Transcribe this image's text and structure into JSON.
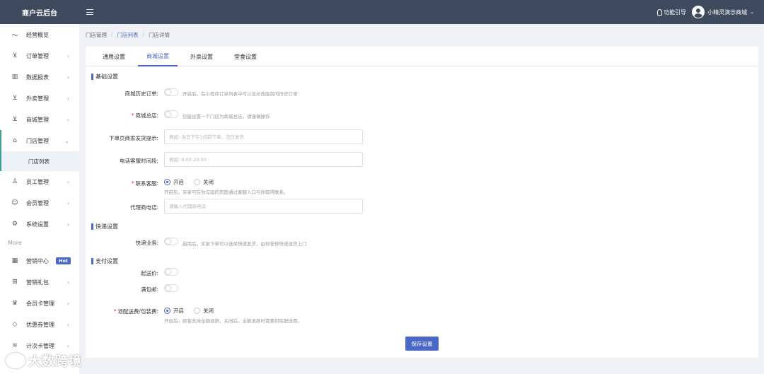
{
  "header": {
    "brand": "商户云后台",
    "guide_label": "功能引导",
    "user_name": "小精灵演示商城",
    "caret": "⌄"
  },
  "sidebar": {
    "items": [
      {
        "label": "经营概览",
        "icon": "trend-chart-icon",
        "glyph": "〜",
        "arrow": ""
      },
      {
        "label": "订单管理",
        "icon": "cart-icon",
        "glyph": "⊻",
        "arrow": "›"
      },
      {
        "label": "数据报表",
        "icon": "bar-chart-icon",
        "glyph": "▥",
        "arrow": "›"
      },
      {
        "label": "外卖管理",
        "icon": "cart-icon",
        "glyph": "⊻",
        "arrow": "›"
      },
      {
        "label": "商城管理",
        "icon": "cart-icon",
        "glyph": "⊻",
        "arrow": "›"
      },
      {
        "label": "门店管理",
        "icon": "home-icon",
        "glyph": "⌂",
        "arrow": "⌄"
      }
    ],
    "sub_item": "门店列表",
    "items2": [
      {
        "label": "员工管理",
        "icon": "user-icon",
        "glyph": "♙",
        "arrow": "›"
      },
      {
        "label": "会员管理",
        "icon": "smile-icon",
        "glyph": "☺",
        "arrow": "›"
      },
      {
        "label": "系统设置",
        "icon": "gear-icon",
        "glyph": "⚙",
        "arrow": "›"
      }
    ],
    "more_label": "More",
    "items3": [
      {
        "label": "营销中心",
        "icon": "grid-icon",
        "glyph": "▦",
        "arrow": "",
        "badge": "Hot"
      },
      {
        "label": "营销礼包",
        "icon": "gift-icon",
        "glyph": "⊞",
        "arrow": "›"
      },
      {
        "label": "会员卡管理",
        "icon": "crown-icon",
        "glyph": "♛",
        "arrow": "›"
      },
      {
        "label": "优惠券管理",
        "icon": "tag-icon",
        "glyph": "◇",
        "arrow": "›"
      },
      {
        "label": "计次卡管理",
        "icon": "layers-icon",
        "glyph": "≋",
        "arrow": "›"
      }
    ]
  },
  "breadcrumb": [
    "门店管理",
    "门店列表",
    "门店详情"
  ],
  "tabs": [
    "通用设置",
    "商城设置",
    "外卖设置",
    "堂食设置"
  ],
  "sections": {
    "basic": "基础设置",
    "express": "快递设置",
    "payment": "支付设置"
  },
  "form": {
    "history_order_label": "商城历史订单:",
    "history_order_hint": "开启后，在小程序订单列表中可以显示改版前的历史订单",
    "main_store_label": "商城总店:",
    "main_store_hint": "仅能设置一个门店为商城总店，请谨慎操作",
    "ship_tip_label": "下单页商家发货提示:",
    "ship_tip_placeholder": "例如: 当日下午3点前下单，次日发货",
    "service_time_label": "电话客服时间段:",
    "service_time_placeholder": "例如: 9:00-20:00",
    "contact_label": "联系客服:",
    "contact_on": "开启",
    "contact_off": "关闭",
    "contact_hint": "开启后，买家可在你勾选的页面通过客服入口与你取得联系。",
    "agent_phone_label": "代理商电话:",
    "agent_phone_placeholder": "请输入代理商电话",
    "express_label": "快递业务:",
    "express_hint": "启用后，买家下单可以选择快递发货，由你安排快递送货上门",
    "min_price_label": "起送价:",
    "free_ship_label": "满包邮:",
    "refund_label": "退配送费/包装费:",
    "refund_on": "开启",
    "refund_off": "关闭",
    "refund_hint": "开启后，顾客支持全额退款，关闭后，全额退款时需要扣除配送费。",
    "save_label": "保存设置"
  },
  "watermark": "大数跨境",
  "colors": {
    "accent": "#4a69c6",
    "header": "#3f4a5e",
    "active_border": "#3f9f93"
  }
}
